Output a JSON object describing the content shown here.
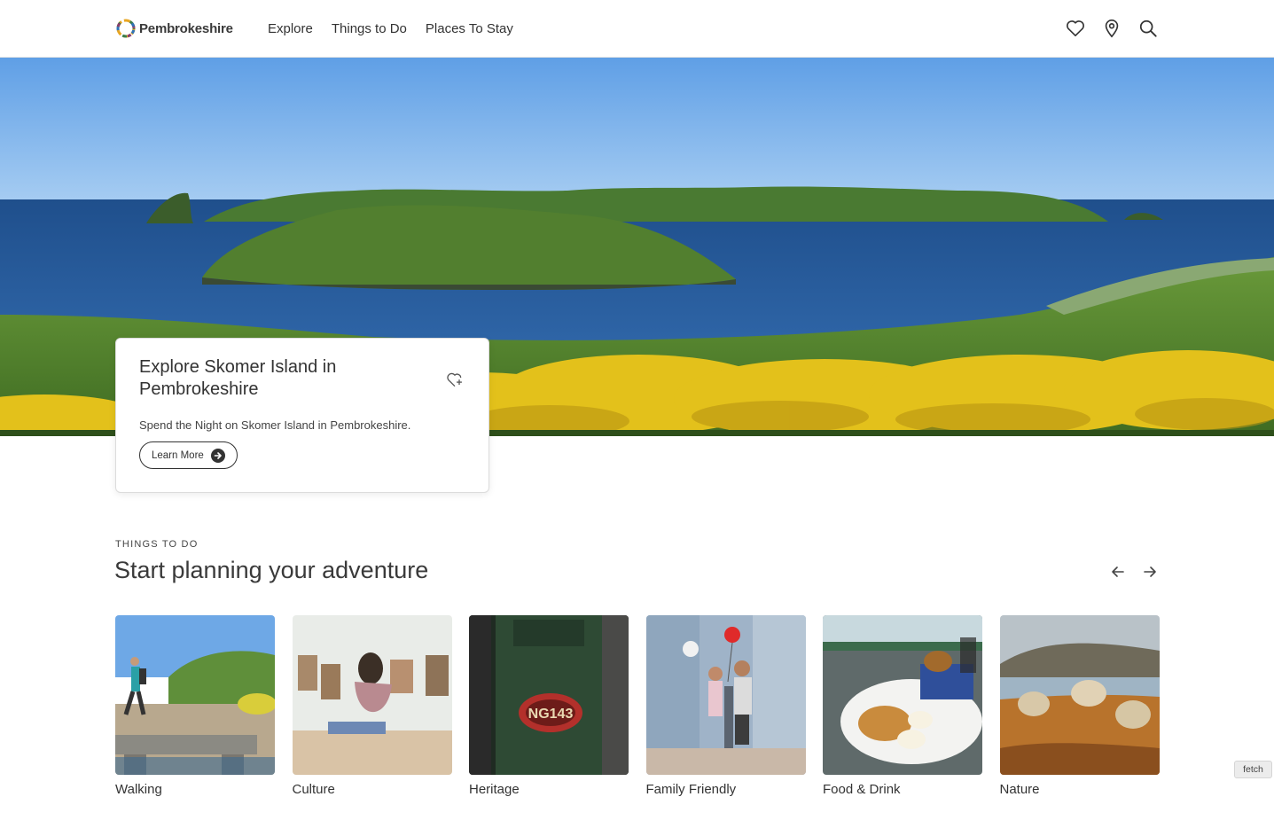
{
  "header": {
    "logo_text": "Pembrokeshire",
    "nav": [
      "Explore",
      "Things to Do",
      "Places To Stay"
    ],
    "icons": [
      "heart-icon",
      "map-pin-icon",
      "search-icon"
    ]
  },
  "hero": {
    "card_title": "Explore Skomer Island in Pembrokeshire",
    "card_text": "Spend the Night on Skomer Island in Pembrokeshire.",
    "button_label": "Learn More"
  },
  "section": {
    "eyebrow": "THINGS TO DO",
    "title": "Start planning your adventure"
  },
  "tiles": [
    {
      "label": "Walking"
    },
    {
      "label": "Culture"
    },
    {
      "label": "Heritage"
    },
    {
      "label": "Family Friendly"
    },
    {
      "label": "Food & Drink"
    },
    {
      "label": "Nature"
    }
  ],
  "badge": "fetch",
  "colors": {
    "text": "#333333",
    "sky": "#7bb3ec",
    "sea": "#2c5f9e",
    "island": "#4e7d2f",
    "gorse": "#e3c11b"
  }
}
